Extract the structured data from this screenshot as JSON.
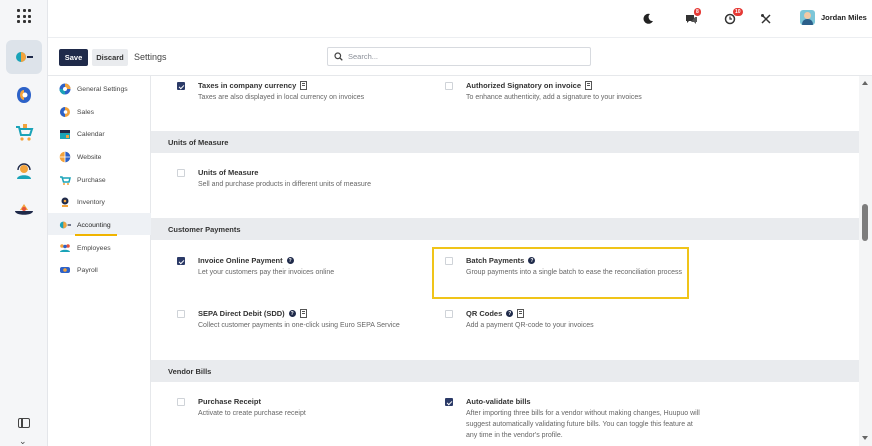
{
  "topbar": {
    "chat_badge": "8",
    "activity_badge": "10",
    "user_name": "Jordan Miles"
  },
  "control": {
    "save_label": "Save",
    "discard_label": "Discard",
    "breadcrumb": "Settings",
    "search_placeholder": "Search..."
  },
  "sidebar": {
    "items": [
      {
        "label": "General Settings",
        "icon": "general-settings-icon"
      },
      {
        "label": "Sales",
        "icon": "sales-icon"
      },
      {
        "label": "Calendar",
        "icon": "calendar-icon"
      },
      {
        "label": "Website",
        "icon": "website-icon"
      },
      {
        "label": "Purchase",
        "icon": "purchase-icon"
      },
      {
        "label": "Inventory",
        "icon": "inventory-icon"
      },
      {
        "label": "Accounting",
        "icon": "accounting-icon",
        "active": true
      },
      {
        "label": "Employees",
        "icon": "employees-icon"
      },
      {
        "label": "Payroll",
        "icon": "payroll-icon"
      }
    ]
  },
  "sections": {
    "units": {
      "title": "Units of Measure"
    },
    "payments": {
      "title": "Customer Payments"
    },
    "vendor": {
      "title": "Vendor Bills"
    }
  },
  "settings": {
    "taxes_currency": {
      "title": "Taxes in company currency",
      "desc": "Taxes are also displayed in local currency on invoices",
      "checked": true
    },
    "authorized_signatory": {
      "title": "Authorized Signatory on invoice",
      "desc": "To enhance authenticity, add a signature to your invoices",
      "checked": false
    },
    "units_of_measure": {
      "title": "Units of Measure",
      "desc": "Sell and purchase products in different units of measure",
      "checked": false
    },
    "invoice_online_payment": {
      "title": "Invoice Online Payment",
      "desc": "Let your customers pay their invoices online",
      "checked": true
    },
    "batch_payments": {
      "title": "Batch Payments",
      "desc": "Group payments into a single batch to ease the reconciliation process",
      "checked": false
    },
    "sepa_direct_debit": {
      "title": "SEPA Direct Debit (SDD)",
      "desc": "Collect customer payments in one-click using Euro SEPA Service",
      "checked": false
    },
    "qr_codes": {
      "title": "QR Codes",
      "desc": "Add a payment QR-code to your invoices",
      "checked": false
    },
    "purchase_receipt": {
      "title": "Purchase Receipt",
      "desc": "Activate to create purchase receipt",
      "checked": false
    },
    "auto_validate_bills": {
      "title": "Auto-validate bills",
      "desc": "After importing three bills for a vendor without making changes, Huupuo will suggest automatically validating future bills. You can toggle this feature at any time in the vendor's profile.",
      "checked": true
    }
  },
  "colors": {
    "primary": "#1f2a4a",
    "highlight": "#f0c419",
    "active_underline": "#f0b400",
    "badge": "#e53935"
  }
}
